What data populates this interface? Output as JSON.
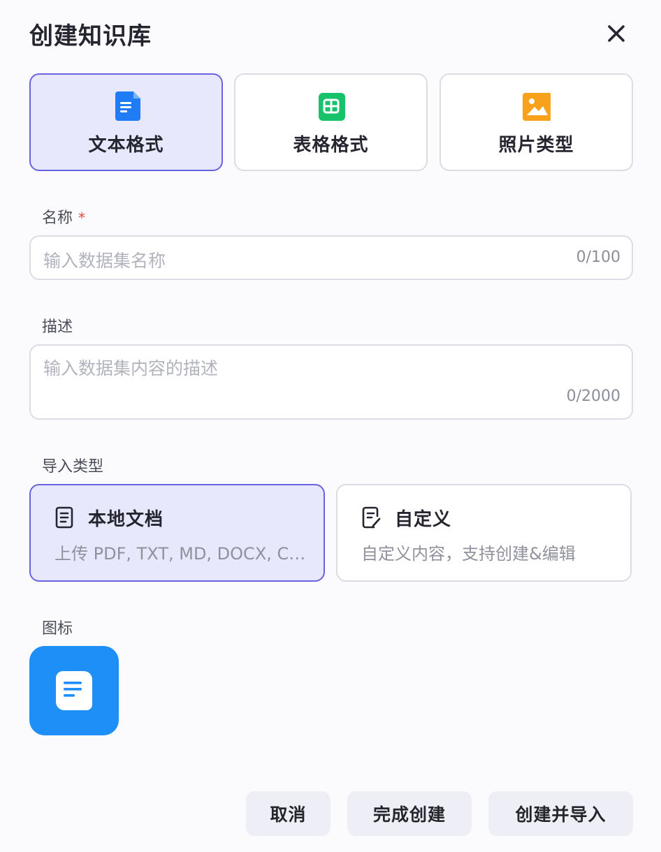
{
  "dialog": {
    "title": "创建知识库",
    "close_icon": "close-icon"
  },
  "formats": [
    {
      "label": "文本格式",
      "icon": "text-doc-icon",
      "color": "#1f7cf5",
      "selected": true
    },
    {
      "label": "表格格式",
      "icon": "table-icon",
      "color": "#16c26a",
      "selected": false
    },
    {
      "label": "照片类型",
      "icon": "image-icon",
      "color": "#f7a21a",
      "selected": false
    }
  ],
  "name_field": {
    "label": "名称",
    "required_mark": "*",
    "placeholder": "输入数据集名称",
    "counter": "0/100"
  },
  "desc_field": {
    "label": "描述",
    "placeholder": "输入数据集内容的描述",
    "counter": "0/2000"
  },
  "import_type": {
    "label": "导入类型",
    "options": [
      {
        "title": "本地文档",
        "desc": "上传 PDF, TXT, MD, DOCX, CSV 格式的文件",
        "icon": "document-icon",
        "selected": true
      },
      {
        "title": "自定义",
        "desc": "自定义内容，支持创建&编辑",
        "icon": "edit-document-icon",
        "selected": false
      }
    ]
  },
  "icon_field": {
    "label": "图标",
    "icon": "doc-icon",
    "bg_color": "#1f8ff8"
  },
  "buttons": {
    "cancel": "取消",
    "finish": "完成创建",
    "create_import": "创建并导入"
  },
  "colors": {
    "accent": "#6a63e0",
    "selected_bg": "#e8e8fd",
    "required": "#e8462f"
  }
}
